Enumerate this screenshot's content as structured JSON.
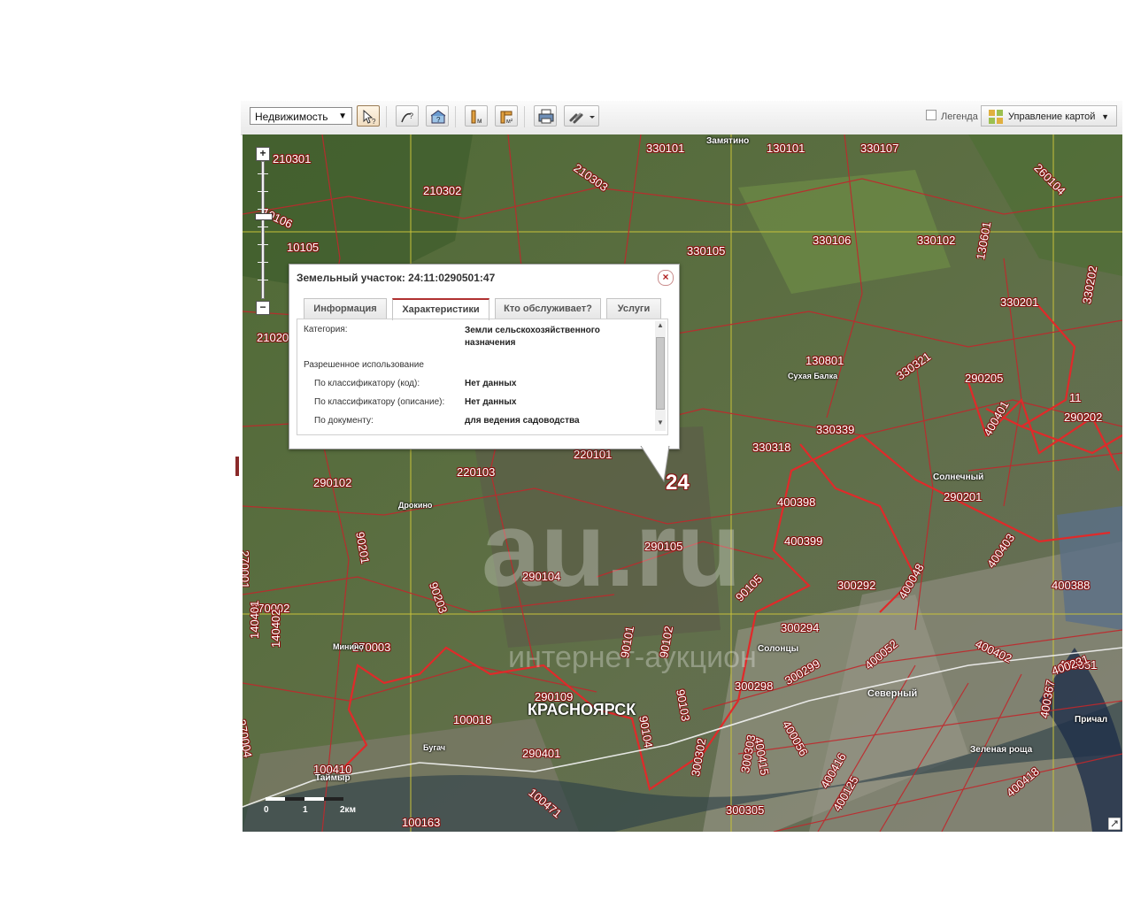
{
  "toolbar": {
    "layer_select": "Недвижимость",
    "legend_label": "Легенда",
    "map_control_label": "Управление картой"
  },
  "map": {
    "watermark_logo": "au.ru",
    "watermark_subtitle": "интернет-аукцион",
    "cadastral_labels": [
      "210301",
      "210302",
      "210303",
      "330101",
      "130101",
      "330107",
      "260104",
      "10106",
      "10105",
      "210201",
      "330105",
      "330106",
      "330102",
      "130601",
      "330201",
      "330202",
      "130801",
      "330321",
      "290205",
      "11",
      "290202",
      "400401",
      "220101",
      "220103",
      "330318",
      "330339",
      "290102",
      "24",
      "290201",
      "90201",
      "290105",
      "400398",
      "400399",
      "270001",
      "90203",
      "290104",
      "90105",
      "300292",
      "400048",
      "400403",
      "400388",
      "270002",
      "270003",
      "140401",
      "140402",
      "300294",
      "90101",
      "90102",
      "400402",
      "400051",
      "400231",
      "300298",
      "300299",
      "400052",
      "270004",
      "290109",
      "90103",
      "90104",
      "400056",
      "400415",
      "100018",
      "290401",
      "300302",
      "300303",
      "400418",
      "300305",
      "400416",
      "400125",
      "100410",
      "100471",
      "100163",
      "400367"
    ],
    "place_names": [
      "Замятино",
      "Сухая Балка",
      "Солнечный",
      "Дрокино",
      "Минино",
      "Солонцы",
      "Северный",
      "Красноярск",
      "Бугач",
      "Таймыр",
      "Зеленая роща",
      "Причал"
    ],
    "scale": {
      "labels": [
        "0",
        "1",
        "2км"
      ]
    }
  },
  "popup": {
    "title": "Земельный участок: 24:11:0290501:47",
    "tabs": [
      "Информация",
      "Характеристики",
      "Кто обслуживает?",
      "Услуги"
    ],
    "active_tab": "Характеристики",
    "rows": [
      {
        "label": "Категория:",
        "value": "Земли сельскохозяйственного назначения"
      },
      {
        "label": "Разрешенное использование",
        "value": ""
      },
      {
        "label": "По классификатору (код):",
        "value": "Нет данных"
      },
      {
        "label": "По классификатору (описание):",
        "value": "Нет данных"
      },
      {
        "label": "По документу:",
        "value": "для ведения садоводства"
      }
    ]
  }
}
